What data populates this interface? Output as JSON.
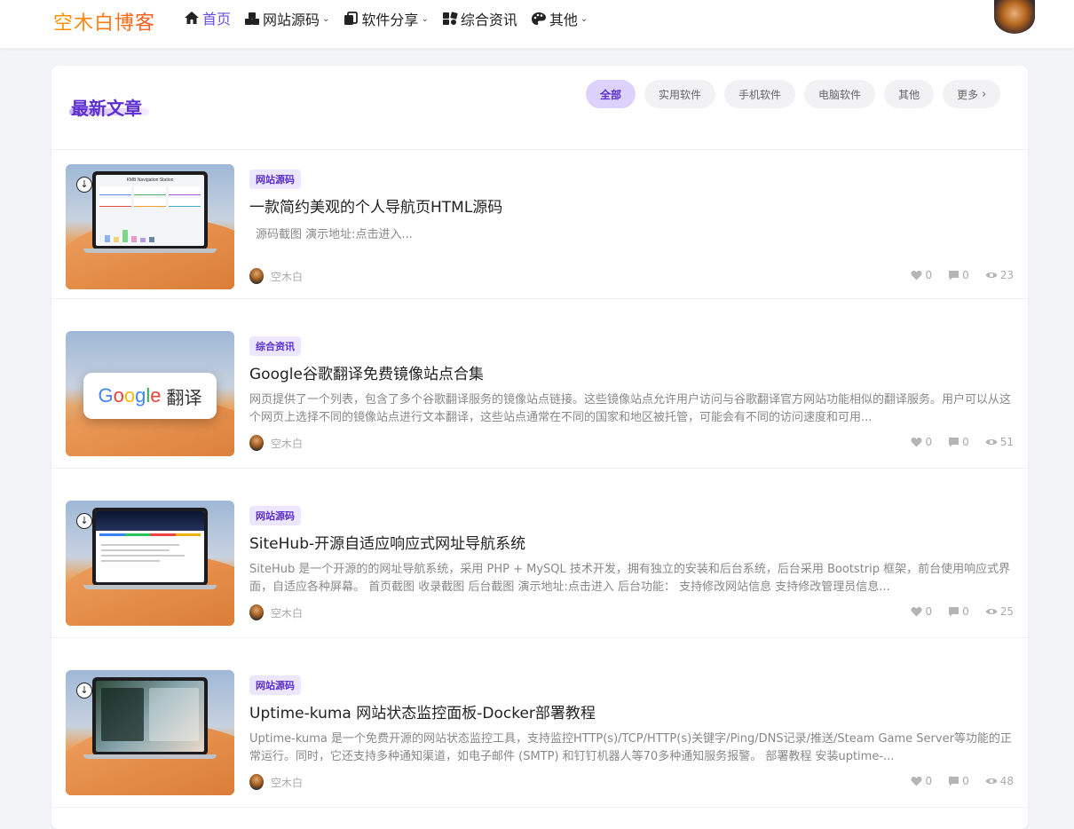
{
  "header": {
    "logo": "空木白博客",
    "nav": [
      {
        "label": "首页",
        "icon": "home-icon",
        "chevron": false,
        "active": true
      },
      {
        "label": "网站源码",
        "icon": "cubes-icon",
        "chevron": true
      },
      {
        "label": "软件分享",
        "icon": "copy-icon",
        "chevron": true
      },
      {
        "label": "综合资讯",
        "icon": "dice-icon",
        "chevron": false
      },
      {
        "label": "其他",
        "icon": "palette-icon",
        "chevron": true
      }
    ]
  },
  "section": {
    "title": "最新文章",
    "filters": [
      "全部",
      "实用软件",
      "手机软件",
      "电脑软件",
      "其他",
      "更多"
    ],
    "active_filter": "全部"
  },
  "posts": [
    {
      "category": "网站源码",
      "title": "一款简约美观的个人导航页HTML源码",
      "excerpt": "源码截图 演示地址:点击进入...",
      "author": "空木白",
      "likes": "0",
      "comments": "0",
      "views": "23",
      "thumb_text": "KMB Navigation Station"
    },
    {
      "category": "综合资讯",
      "title": "Google谷歌翻译免费镜像站点合集",
      "excerpt": "网页提供了一个列表，包含了多个谷歌翻译服务的镜像站点链接。这些镜像站点允许用户访问与谷歌翻译官方网站功能相似的翻译服务。用户可以从这个网页上选择不同的镜像站点进行文本翻译，这些站点通常在不同的国家和地区被托管，可能会有不同的访问速度和可用...",
      "author": "空木白",
      "likes": "0",
      "comments": "0",
      "views": "51",
      "thumb_text": "翻译"
    },
    {
      "category": "网站源码",
      "title": "SiteHub-开源自适应响应式网址导航系统",
      "excerpt": "SiteHub 是一个开源的的网址导航系统，采用 PHP + MySQL 技术开发，拥有独立的安装和后台系统，后台采用 Bootstrip 框架，前台使用响应式界面，自适应各种屏幕。 首页截图 收录截图 后台截图 演示地址:点击进入 后台功能： 支持修改网站信息 支持修改管理员信息...",
      "author": "空木白",
      "likes": "0",
      "comments": "0",
      "views": "25"
    },
    {
      "category": "网站源码",
      "title": "Uptime-kuma 网站状态监控面板-Docker部署教程",
      "excerpt": "Uptime-kuma 是一个免费开源的网站状态监控工具，支持监控HTTP(s)/TCP/HTTP(s)关键字/Ping/DNS记录/推送/Steam Game Server等功能的正常运行。同时，它还支持多种通知渠道，如电子邮件 (SMTP) 和钉钉机器人等70多种通知服务报警。 部署教程 安装uptime-...",
      "author": "空木白",
      "likes": "0",
      "comments": "0",
      "views": "48"
    }
  ],
  "colors": {
    "accent": "#5b2fd0",
    "tag_bg": "#ece6ff",
    "chip_active_bg": "#ddd2fb"
  }
}
